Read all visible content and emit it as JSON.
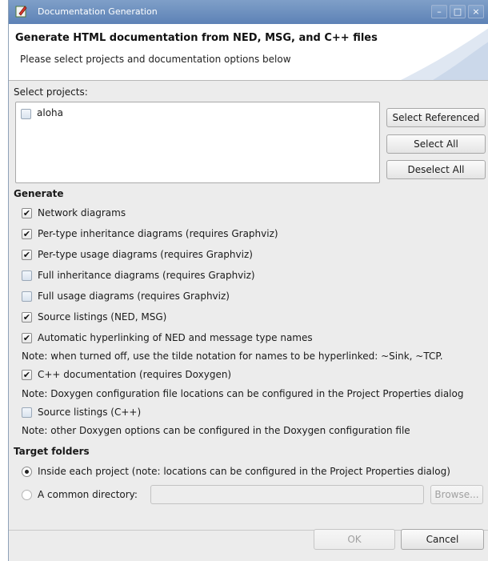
{
  "window": {
    "title": "Documentation Generation",
    "minimize_glyph": "–",
    "maximize_glyph": "□",
    "close_glyph": "×"
  },
  "header": {
    "title": "Generate HTML documentation from NED, MSG, and C++ files",
    "subtitle": "Please select projects and documentation options below"
  },
  "projects": {
    "label": "Select projects:",
    "items": [
      {
        "label": "aloha",
        "checked": false
      }
    ],
    "buttons": {
      "select_referenced": "Select Referenced",
      "select_all": "Select All",
      "deselect_all": "Deselect All"
    }
  },
  "generate": {
    "label": "Generate",
    "options": [
      {
        "label": "Network diagrams",
        "checked": true
      },
      {
        "label": "Per-type inheritance diagrams (requires Graphviz)",
        "checked": true
      },
      {
        "label": "Per-type usage diagrams (requires Graphviz)",
        "checked": true
      },
      {
        "label": "Full inheritance diagrams (requires Graphviz)",
        "checked": false
      },
      {
        "label": "Full usage diagrams (requires Graphviz)",
        "checked": false
      },
      {
        "label": "Source listings (NED, MSG)",
        "checked": true
      },
      {
        "label": "Automatic hyperlinking of NED and message type names",
        "checked": true
      },
      {
        "label": "C++ documentation (requires Doxygen)",
        "checked": true
      },
      {
        "label": "Source listings (C++)",
        "checked": false
      }
    ],
    "notes": [
      "Note: when turned off, use the tilde notation for names to be hyperlinked: ~Sink, ~TCP.",
      "Note: Doxygen configuration file locations can be configured in the Project Properties dialog",
      "Note: other Doxygen options can be configured in the Doxygen configuration file"
    ]
  },
  "target": {
    "label": "Target folders",
    "option_inside": "Inside each project (note: locations can be configured in the Project Properties dialog)",
    "option_common": "A common directory:",
    "selected": "inside",
    "directory_value": "",
    "browse": "Browse..."
  },
  "footer": {
    "ok": "OK",
    "cancel": "Cancel"
  }
}
